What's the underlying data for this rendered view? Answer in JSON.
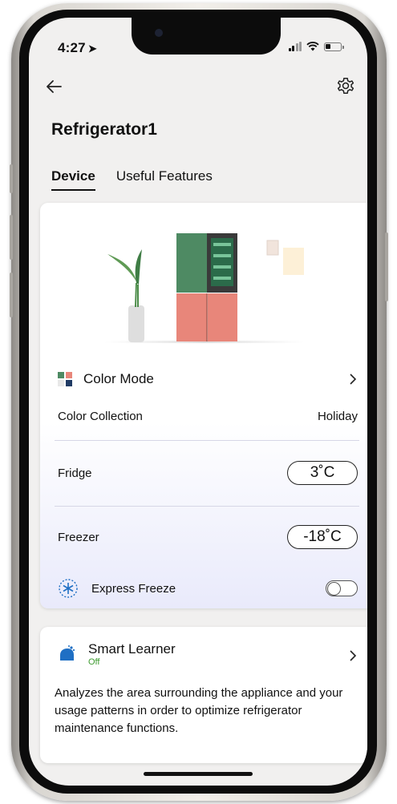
{
  "status_bar": {
    "time": "4:27",
    "location_arrow": "➤"
  },
  "header": {
    "title": "Refrigerator1"
  },
  "tabs": [
    {
      "label": "Device",
      "active": true
    },
    {
      "label": "Useful Features",
      "active": false
    }
  ],
  "device_card": {
    "color_mode": {
      "label": "Color Mode",
      "icon": "color-mode-icon"
    },
    "color_collection": {
      "label": "Color Collection",
      "value": "Holiday"
    },
    "fridge": {
      "label": "Fridge",
      "value": "3˚C"
    },
    "freezer": {
      "label": "Freezer",
      "value": "-18˚C"
    },
    "express_freeze": {
      "label": "Express Freeze",
      "enabled": false
    }
  },
  "smart_learner": {
    "title": "Smart Learner",
    "status": "Off",
    "description": "Analyzes the area surrounding the appliance and your usage patterns in order to optimize refrigerator maintenance functions."
  },
  "colors": {
    "fridge_top": "#4e8a63",
    "fridge_bottom": "#e8867a",
    "status_off": "#3c9b2e",
    "accent_blue": "#1f6fc4"
  }
}
